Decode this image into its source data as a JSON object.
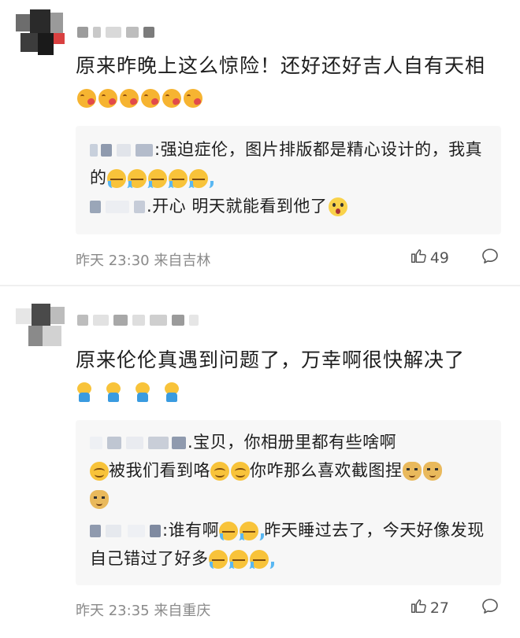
{
  "comments": [
    {
      "text": "原来昨晚上这么惊险！还好还好吉人自有天相",
      "emoji": [
        "kiss-face-icon",
        "kiss-face-icon",
        "kiss-face-icon",
        "kiss-face-icon",
        "kiss-face-icon",
        "kiss-face-icon"
      ],
      "replies": [
        {
          "text": ":强迫症伦，图片排版都是精心设计的，我真的",
          "emoji": [
            "crying-face-icon",
            "crying-face-icon",
            "crying-face-icon",
            "crying-face-icon",
            "crying-face-icon"
          ]
        },
        {
          "text": ".开心 明天就能看到他了",
          "emoji": [
            "shocked-face-icon"
          ]
        }
      ],
      "time": "昨天 23:30 来自吉林",
      "likes": "49"
    },
    {
      "text": "原来伦伦真遇到问题了，万幸啊很快解决了",
      "emoji": [
        "cheering-blob-icon",
        "cheering-blob-icon",
        "cheering-blob-icon",
        "cheering-blob-icon"
      ],
      "replies": [
        {
          "text_a": ".宝贝，你相册里都有些啥啊",
          "text_b": "被我们看到咯",
          "text_c": "你咋那么喜欢截图捏"
        },
        {
          "text_a": ":谁有啊",
          "text_b": " 昨天睡过去了，今天好像发现自己错过了好多"
        }
      ],
      "time": "昨天 23:35 来自重庆",
      "likes": "27"
    }
  ],
  "colors": {
    "reply_bg": "#f7f7f7",
    "meta_text": "#8a8a8a",
    "main_text": "#1e1e1e"
  }
}
